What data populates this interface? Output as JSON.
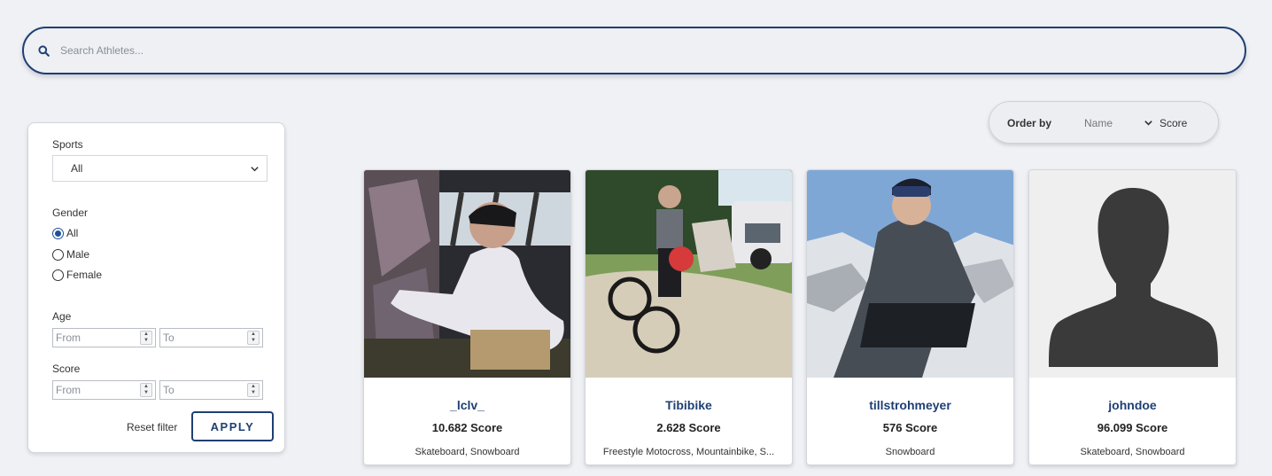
{
  "search": {
    "placeholder": "Search Athletes...",
    "icon": "search-icon"
  },
  "filter": {
    "sports": {
      "label": "Sports",
      "selected": "All"
    },
    "gender": {
      "label": "Gender",
      "options": [
        "All",
        "Male",
        "Female"
      ],
      "selected": "All"
    },
    "age": {
      "label": "Age",
      "from_placeholder": "From",
      "to_placeholder": "To"
    },
    "score": {
      "label": "Score",
      "from_placeholder": "From",
      "to_placeholder": "To"
    },
    "reset_label": "Reset filter",
    "apply_label": "APPLY"
  },
  "order": {
    "label": "Order by",
    "options": [
      "Name",
      "Score"
    ],
    "selected": "Score"
  },
  "athletes": [
    {
      "username": "_lclv_",
      "score": "10.682 Score",
      "sports": "Skateboard, Snowboard"
    },
    {
      "username": "Tibibike",
      "score": "2.628 Score",
      "sports": "Freestyle Motocross, Mountainbike, S..."
    },
    {
      "username": "tillstrohmeyer",
      "score": "576 Score",
      "sports": "Snowboard"
    },
    {
      "username": "johndoe",
      "score": "96.099 Score",
      "sports": "Skateboard, Snowboard"
    }
  ],
  "colors": {
    "accent": "#1f3f74",
    "background": "#eff1f5"
  }
}
